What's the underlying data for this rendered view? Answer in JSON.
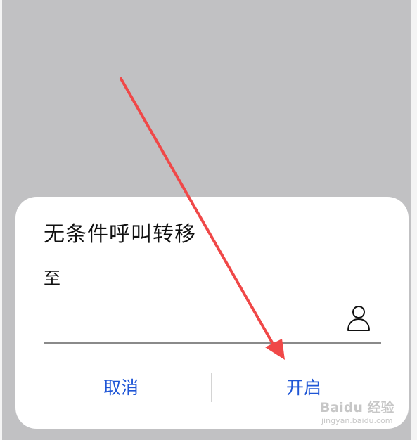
{
  "dialog": {
    "title": "无条件呼叫转移",
    "to_label": "至",
    "number_value": "",
    "contact_icon": "person-icon",
    "cancel_label": "取消",
    "enable_label": "开启"
  },
  "watermark": {
    "brand": "Baidu 经验",
    "url": "jingyan.baidu.com"
  },
  "colors": {
    "backdrop": "#c1c1c3",
    "dialog_bg": "#ffffff",
    "button_text": "#1f56d6",
    "annotation_arrow": "#f04848"
  }
}
